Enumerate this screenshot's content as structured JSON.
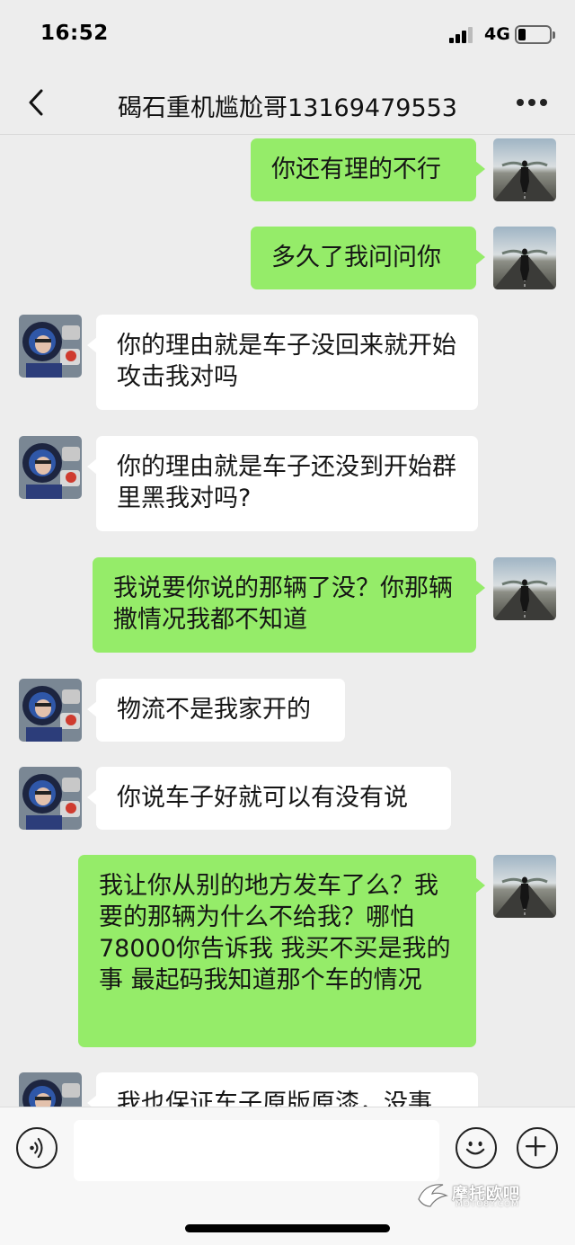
{
  "status_bar": {
    "time": "16:52",
    "network": "4G",
    "icons": [
      "signal-icon",
      "battery-icon"
    ]
  },
  "header": {
    "back_icon": "chevron-left-icon",
    "title": "碣石重机尴尬哥13169479553",
    "more_icon": "more-dots-icon"
  },
  "messages": [
    {
      "sender": "me",
      "text": "你还有理的不行"
    },
    {
      "sender": "me",
      "text": "多久了我问问你"
    },
    {
      "sender": "other",
      "text": "你的理由就是车子没回来就开始攻击我对吗"
    },
    {
      "sender": "other",
      "text": "你的理由就是车子还没到开始群里黑我对吗?"
    },
    {
      "sender": "me",
      "text": "我说要你说的那辆了没？你那辆撒情况我都不知道"
    },
    {
      "sender": "other",
      "text": "物流不是我家开的"
    },
    {
      "sender": "other",
      "text": "你说车子好就可以有没有说"
    },
    {
      "sender": "me",
      "text": "我让你从别的地方发车了么？我要的那辆为什么不给我？哪怕78000你告诉我  我买不买是我的事  最起码我知道那个车的情况"
    },
    {
      "sender": "other",
      "text": "我也保证车子原版原漆，没事"
    }
  ],
  "input_bar": {
    "placeholder": "",
    "icons": [
      "voice-icon",
      "emoji-icon",
      "plus-icon"
    ]
  },
  "watermark": {
    "text": "摩托欧吧",
    "sub": "MOTO8Y.COM"
  },
  "colors": {
    "background": "#ededed",
    "my_bubble": "#95ec69",
    "other_bubble": "#ffffff"
  }
}
